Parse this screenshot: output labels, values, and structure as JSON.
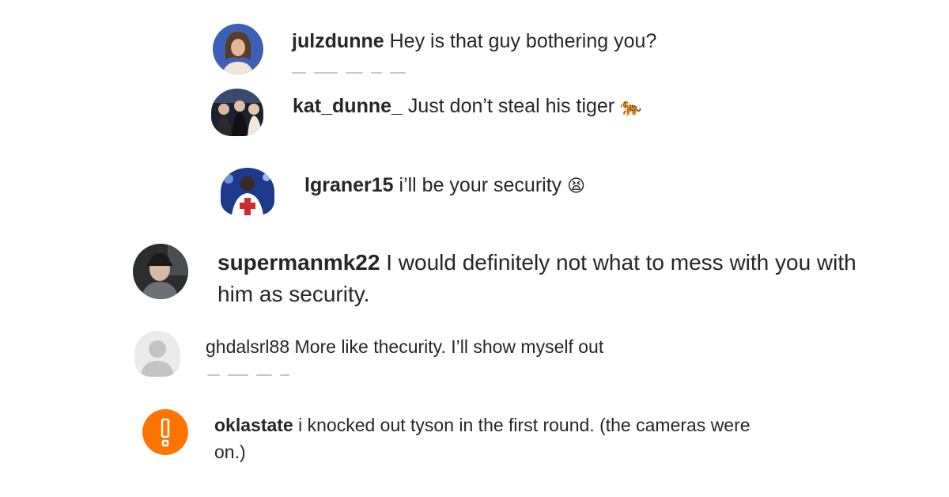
{
  "comments": [
    {
      "username": "julzdunne",
      "text": "Hey is that guy bothering you?",
      "emoji": ""
    },
    {
      "username": "kat_dunne_",
      "text": "Just don’t steal his tiger",
      "emoji": "🐅"
    },
    {
      "username": "lgraner15",
      "text": "i’ll be your security",
      "emoji": "😫"
    },
    {
      "username": "supermanmk22",
      "text": "I would definitely not what to mess with you with him as security.",
      "emoji": ""
    },
    {
      "username": "ghdalsrl88",
      "text": "More like thecurity. I’ll show myself out",
      "emoji": ""
    },
    {
      "username": "oklastate",
      "text": "i knocked out tyson in the first round. (the cameras were on.)",
      "emoji": ""
    }
  ],
  "colors": {
    "text": "#262626",
    "default_avatar_bg": "#e3e3e3",
    "oklastate_avatar": "#ff7300"
  },
  "icons": {
    "default_avatar": "person-silhouette-icon",
    "oklastate_avatar": "exclamation-logo-icon"
  }
}
